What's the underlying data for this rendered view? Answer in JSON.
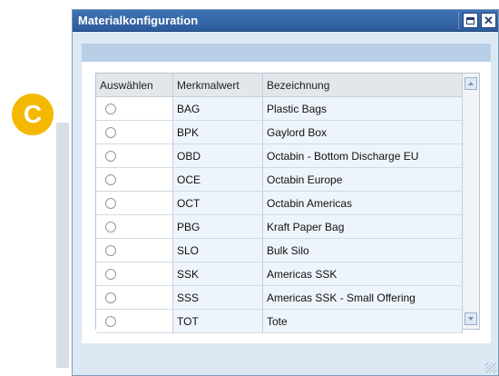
{
  "badge": {
    "letter": "C",
    "color": "#f5b800"
  },
  "window": {
    "title": "Materialkonfiguration",
    "maximize_icon": "maximize-icon",
    "close_icon": "close-icon",
    "close_glyph": "✕"
  },
  "table": {
    "headers": [
      "Auswählen",
      "Merkmalwert",
      "Bezeichnung"
    ],
    "rows": [
      {
        "code": "BAG",
        "name": "Plastic Bags"
      },
      {
        "code": "BPK",
        "name": "Gaylord Box"
      },
      {
        "code": "OBD",
        "name": "Octabin - Bottom Discharge EU"
      },
      {
        "code": "OCE",
        "name": "Octabin Europe"
      },
      {
        "code": "OCT",
        "name": "Octabin  Americas"
      },
      {
        "code": "PBG",
        "name": "Kraft Paper Bag"
      },
      {
        "code": "SLO",
        "name": "Bulk Silo"
      },
      {
        "code": "SSK",
        "name": "Americas SSK"
      },
      {
        "code": "SSS",
        "name": "Americas SSK - Small Offering"
      },
      {
        "code": "TOT",
        "name": "Tote"
      }
    ]
  }
}
